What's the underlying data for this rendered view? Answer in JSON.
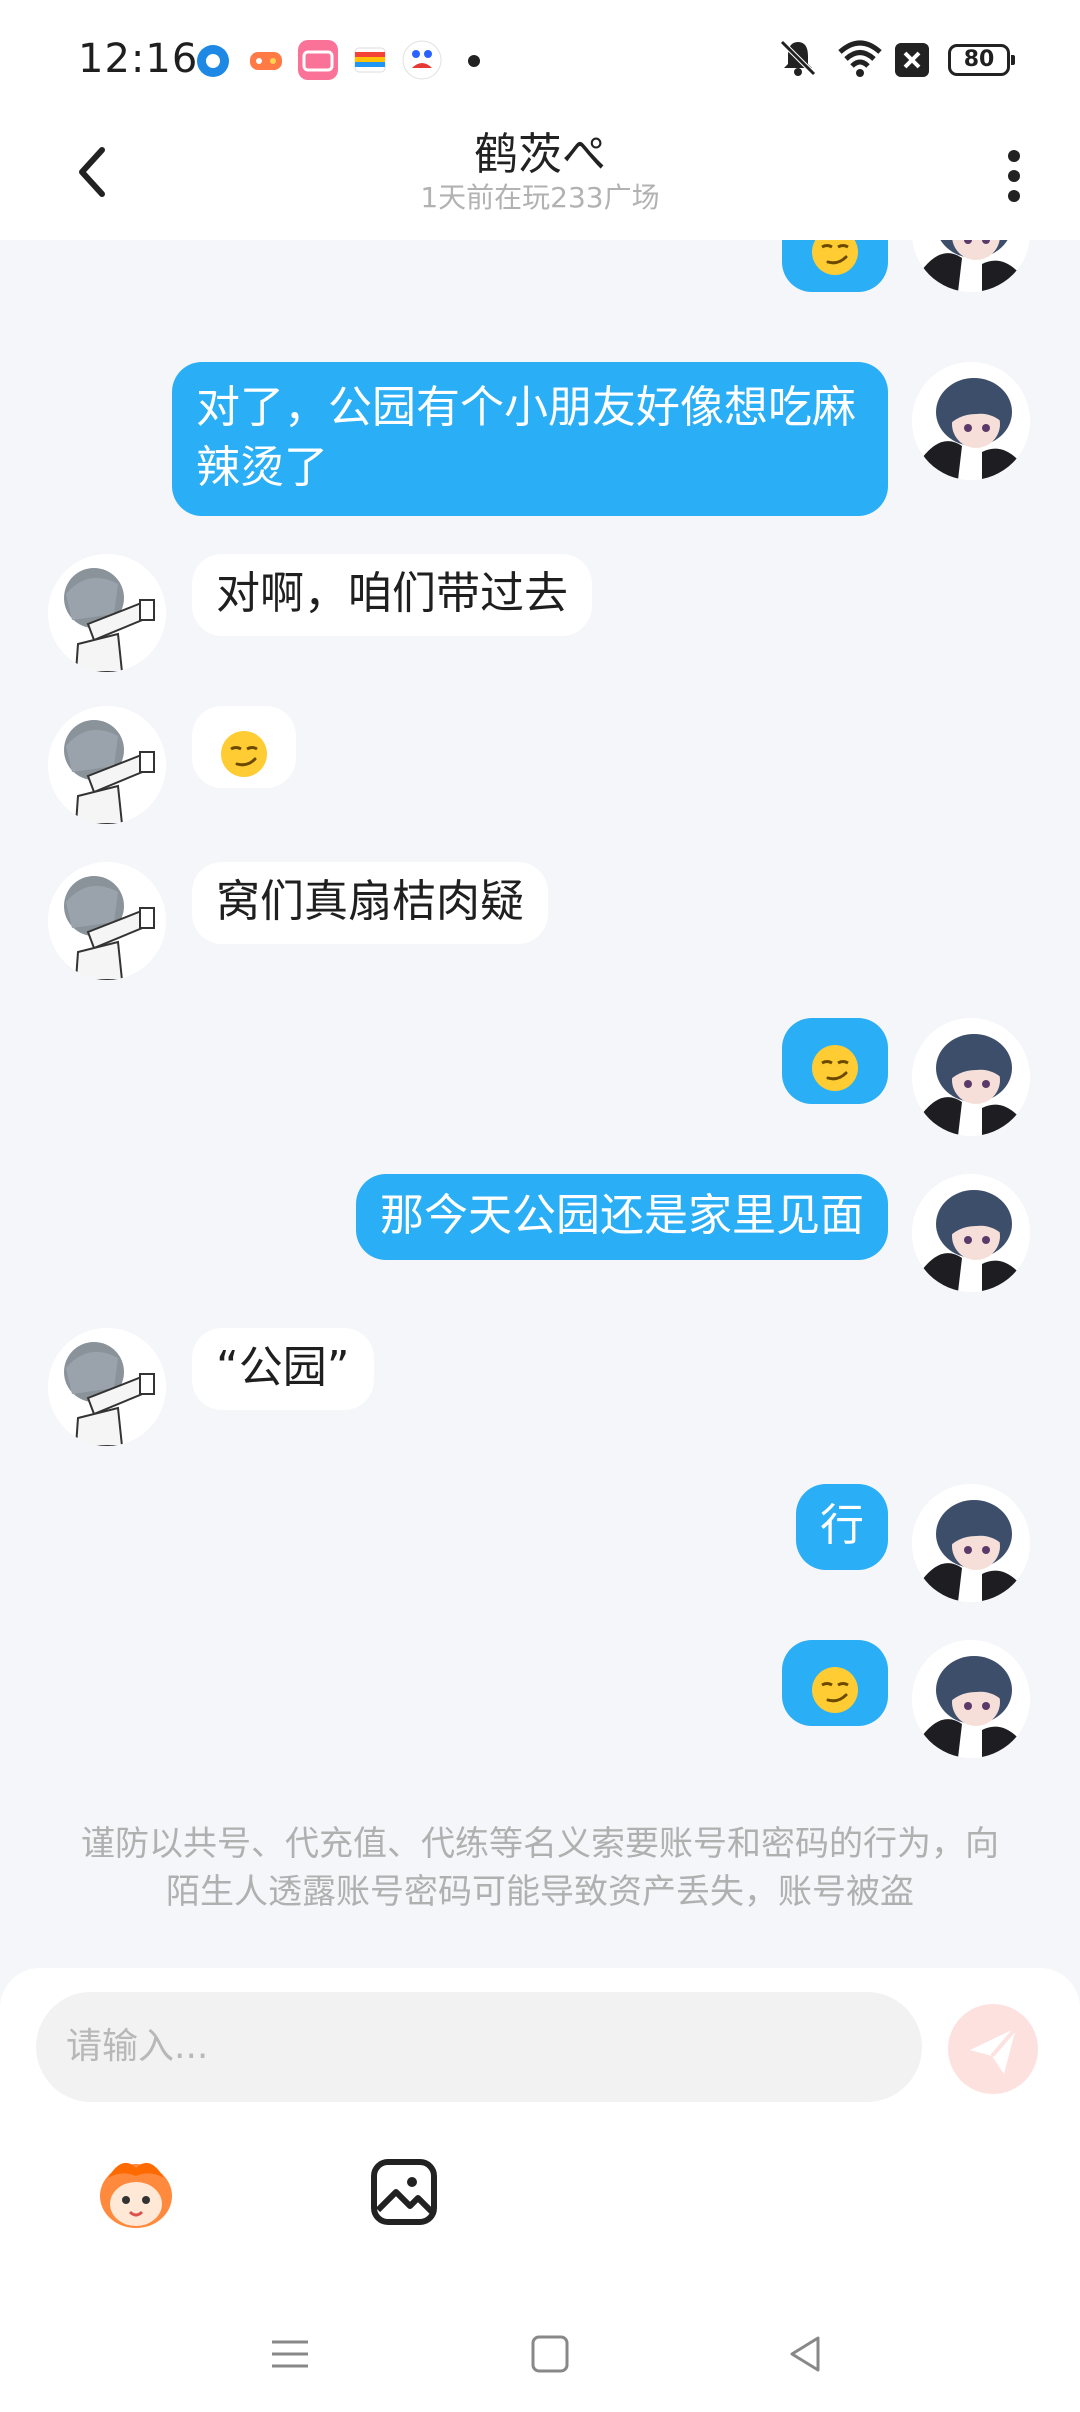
{
  "status_bar": {
    "time": "12:16",
    "battery": "80",
    "icons": [
      "dot-icon",
      "game-icon",
      "bilibili-icon",
      "wallet-icon",
      "baidu-icon",
      "mute-icon",
      "wifi-icon",
      "close-box-icon",
      "battery-icon"
    ]
  },
  "header": {
    "title": "鹤茨ぺ",
    "subtitle": "1天前在玩233广场",
    "back_icon": "chevron-left-icon",
    "more_icon": "more-vertical-icon"
  },
  "messages": [
    {
      "from": "me",
      "type": "emoji",
      "emoji": "smirk"
    },
    {
      "from": "me",
      "type": "text",
      "text": "对了，公园有个小朋友好像想吃麻辣烫了"
    },
    {
      "from": "other",
      "type": "text",
      "text": "对啊，咱们带过去"
    },
    {
      "from": "other",
      "type": "emoji",
      "emoji": "smirk"
    },
    {
      "from": "other",
      "type": "text",
      "text": "窝们真扇桔肉疑"
    },
    {
      "from": "me",
      "type": "emoji",
      "emoji": "smirk"
    },
    {
      "from": "me",
      "type": "text",
      "text": "那今天公园还是家里见面"
    },
    {
      "from": "other",
      "type": "text",
      "text": "“公园”"
    },
    {
      "from": "me",
      "type": "text",
      "text": "行"
    },
    {
      "from": "me",
      "type": "emoji",
      "emoji": "smirk"
    }
  ],
  "warning": "谨防以共号、代充值、代练等名义索要账号和密码的行为，向陌生人透露账号密码可能导致资产丢失，账号被盗",
  "input": {
    "placeholder": "请输入...",
    "value": ""
  },
  "colors": {
    "my_bubble": "#2aaef6",
    "other_bubble": "#ffffff",
    "background": "#f4f6f9",
    "send_button": "#fde1df"
  },
  "nav": [
    "menu-icon",
    "home-square-icon",
    "back-triangle-icon"
  ]
}
